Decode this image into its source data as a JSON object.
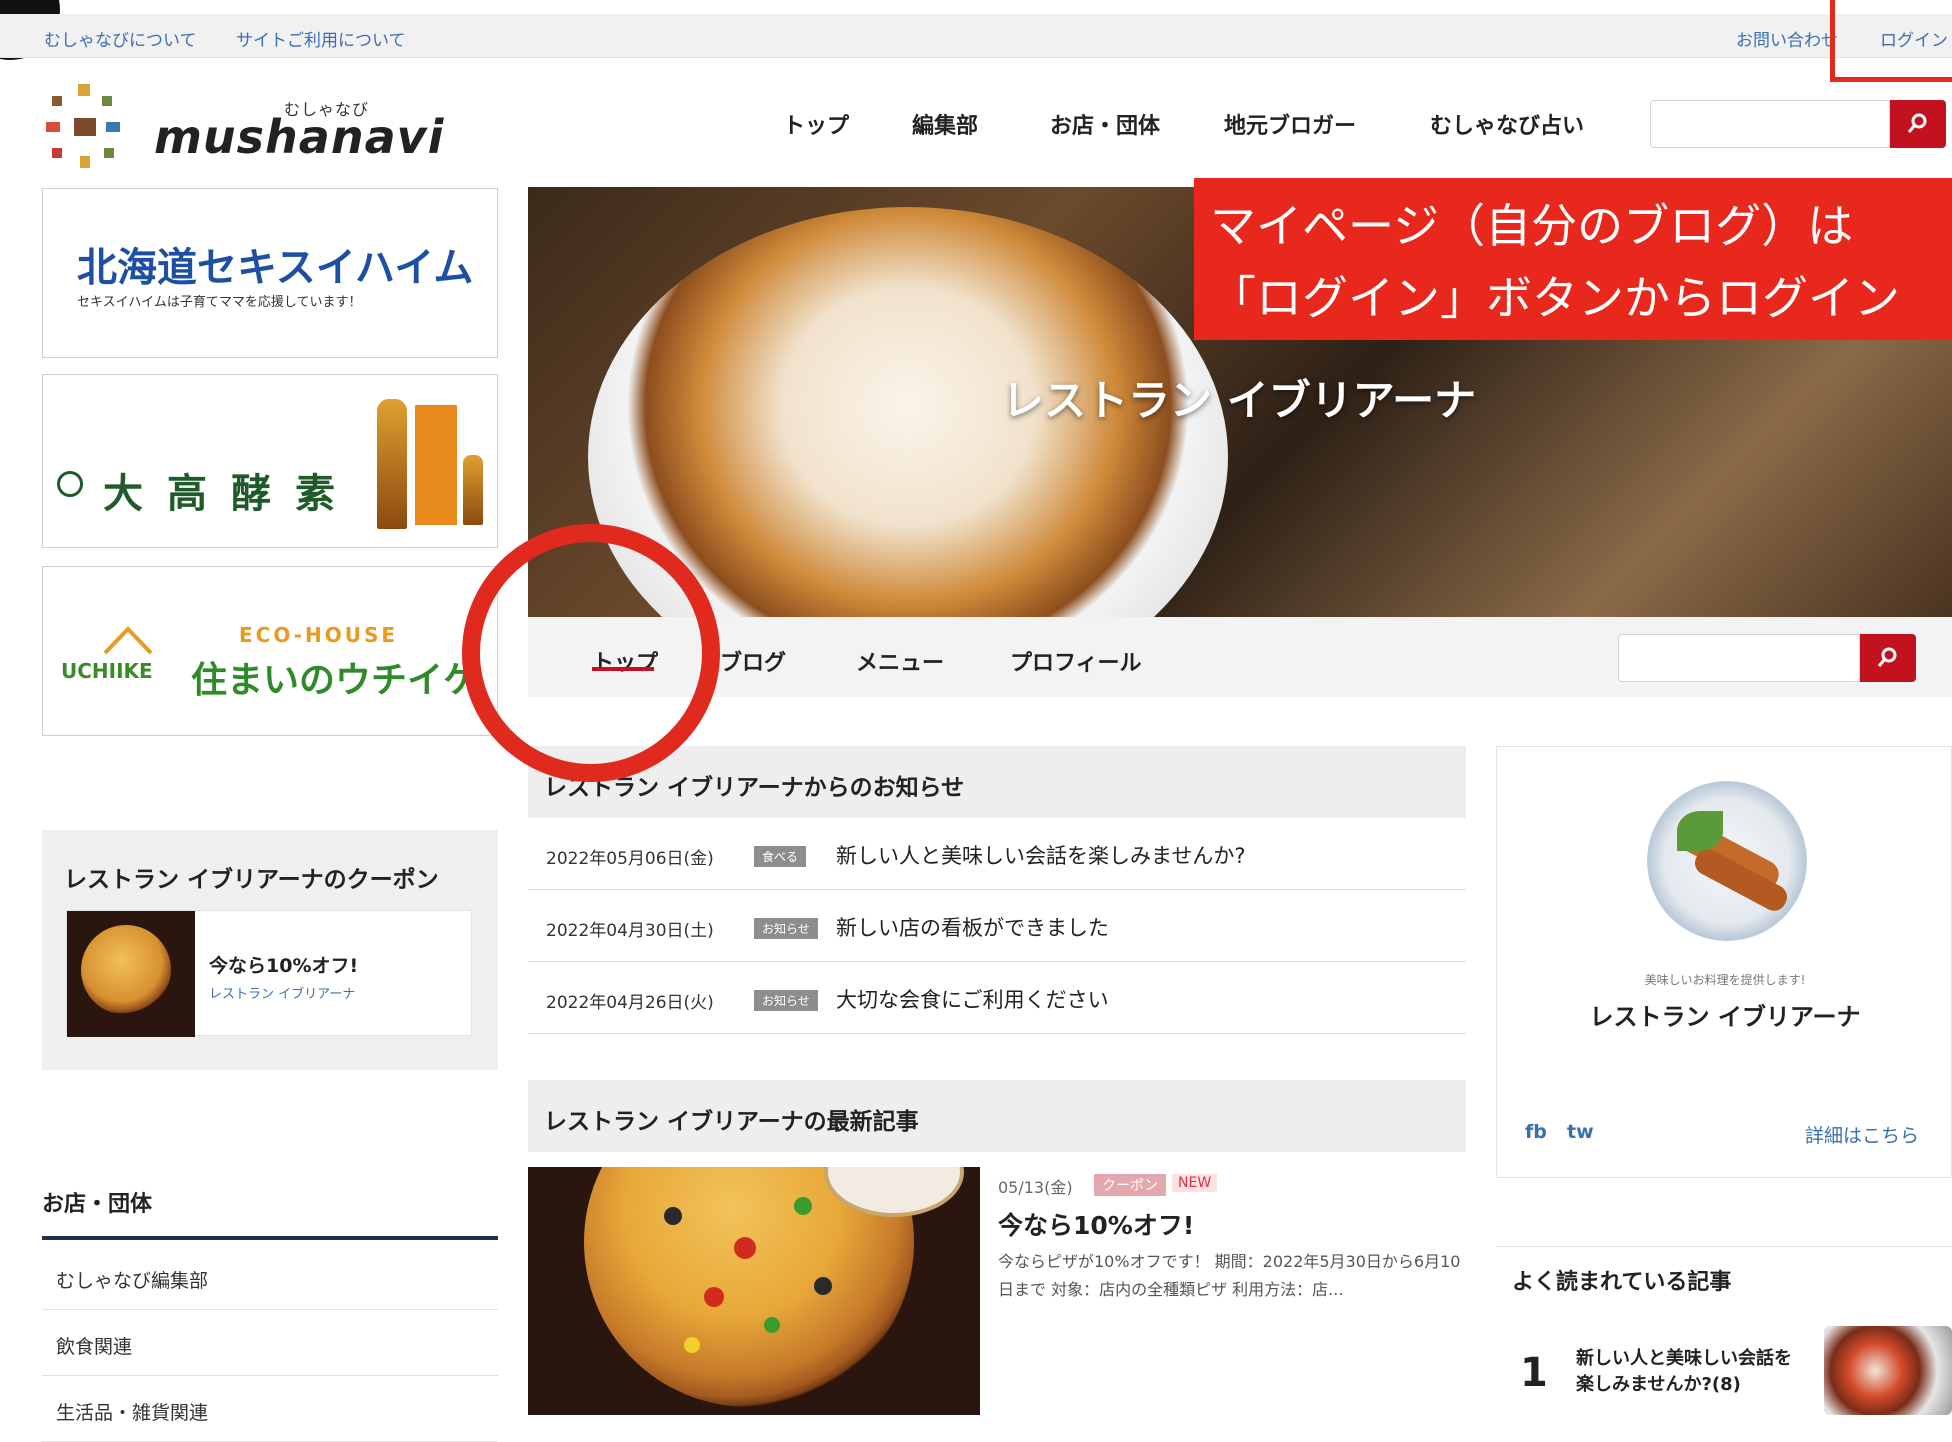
{
  "topbar": {
    "left_links": [
      "むしゃなびについて",
      "サイトご利用について"
    ],
    "right_links": [
      "お問い合わせ",
      "ログイン"
    ]
  },
  "logo": {
    "kana": "むしゃなび",
    "wordmark": "mushanavi"
  },
  "global_nav": [
    "トップ",
    "編集部",
    "お店・団体",
    "地元ブロガー",
    "むしゃなび占い"
  ],
  "search": {
    "header_placeholder": "",
    "shop_placeholder": "",
    "icon": "search-icon"
  },
  "banners": [
    {
      "title": "北海道セキスイハイム",
      "subtitle": "セキスイハイムは子育てママを応援しています！"
    },
    {
      "title": "大高酵素"
    },
    {
      "label_top": "ECO-HOUSE",
      "brand": "UCHIIKE",
      "title": "住まいのウチイケ"
    }
  ],
  "hero": {
    "title": "レストラン イブリアーナ"
  },
  "callout": {
    "line1": "マイページ（自分のブログ）は",
    "line2": "「ログイン」ボタンからログイン"
  },
  "shop_nav": [
    "トップ",
    "ブログ",
    "メニュー",
    "プロフィール"
  ],
  "news": {
    "heading": "レストラン イブリアーナからのお知らせ",
    "items": [
      {
        "date": "2022年05月06日(金)",
        "category": "食べる",
        "title": "新しい人と美味しい会話を楽しみませんか?"
      },
      {
        "date": "2022年04月30日(土)",
        "category": "お知らせ",
        "title": "新しい店の看板ができました"
      },
      {
        "date": "2022年04月26日(火)",
        "category": "お知らせ",
        "title": "大切な会食にご利用ください"
      }
    ]
  },
  "latest": {
    "heading": "レストラン イブリアーナの最新記事",
    "article": {
      "date": "05/13(金)",
      "badge": "クーポン",
      "new_badge": "NEW",
      "title": "今なら10%オフ!",
      "body": "今ならピザが10%オフです！ 期間：2022年5月30日から6月10日まで 対象：店内の全種類ピザ 利用方法：店..."
    }
  },
  "profile": {
    "tagline": "美味しいお料理を提供します!",
    "name": "レストラン イブリアーナ",
    "social": [
      "fb",
      "tw"
    ],
    "more_link": "詳細はこちら"
  },
  "popular": {
    "heading": "よく読まれている記事",
    "items": [
      {
        "rank": "1",
        "title": "新しい人と美味しい会話を楽しみませんか?(8)"
      }
    ]
  },
  "coupon": {
    "heading": "レストラン イブリアーナのクーポン",
    "name": "今なら10%オフ!",
    "shop": "レストラン イブリアーナ"
  },
  "categories": {
    "heading": "お店・団体",
    "items": [
      "むしゃなび編集部",
      "飲食関連",
      "生活品・雑貨関連"
    ]
  },
  "colors": {
    "accent_red": "#c3121f",
    "annotation_red": "#e02a1e",
    "link_blue": "#3a6fb2"
  }
}
